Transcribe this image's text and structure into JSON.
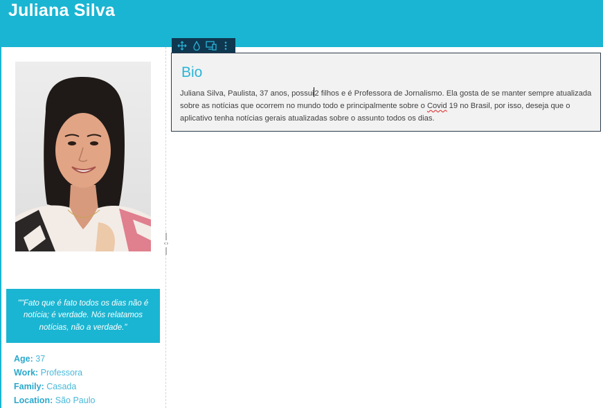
{
  "header": {
    "title": "Juliana Silva",
    "bg_color": "#1ab5d2"
  },
  "quote": {
    "text": "\"\"Fato que é fato todos os dias não é notícia; é verdade. Nós relatamos notícias, não a verdade.\""
  },
  "info": [
    {
      "label": "Age:",
      "value": "37"
    },
    {
      "label": "Work:",
      "value": "Professora"
    },
    {
      "label": "Family:",
      "value": "Casada"
    },
    {
      "label": "Location:",
      "value": "São Paulo"
    }
  ],
  "toolbar": {
    "icons": [
      "move-icon",
      "fill-drop-icon",
      "responsive-icon",
      "more-vertical-icon"
    ]
  },
  "bio": {
    "title": "Bio",
    "text_part1": "Juliana Silva, Paulista, 37 anos, possui",
    "text_part2": "2 filhos e é Professora de Jornalismo. Ela gosta de se manter sempre atualizada sobre as notícias que ocorrem no mundo todo e principalmente sobre o ",
    "text_spell": "Covid",
    "text_part3": " 19 no Brasil, por isso, deseja que o aplicativo tenha notícias gerais atualizadas sobre o assunto todos os dias."
  },
  "resize_handle": {
    "glyph": "‹›"
  }
}
